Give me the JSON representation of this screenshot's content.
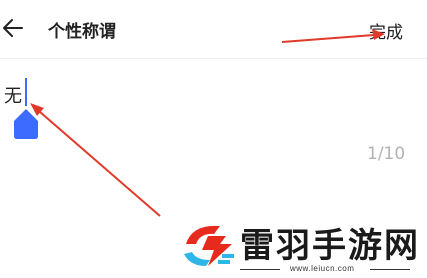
{
  "header": {
    "back_icon": "arrow-left-icon",
    "title": "个性称谓",
    "done_label": "完成"
  },
  "input": {
    "value": "无",
    "counter": "1/10",
    "caret_color": "#3d6bff"
  },
  "annotations": {
    "arrow_color": "#e03a2a"
  },
  "watermark": {
    "name": "雷羽手游网",
    "url": "www.leiucn.com",
    "logo_icon": "lightning-logo-icon",
    "accent_red": "#e62b1e",
    "accent_blue": "#2fb6e8"
  }
}
